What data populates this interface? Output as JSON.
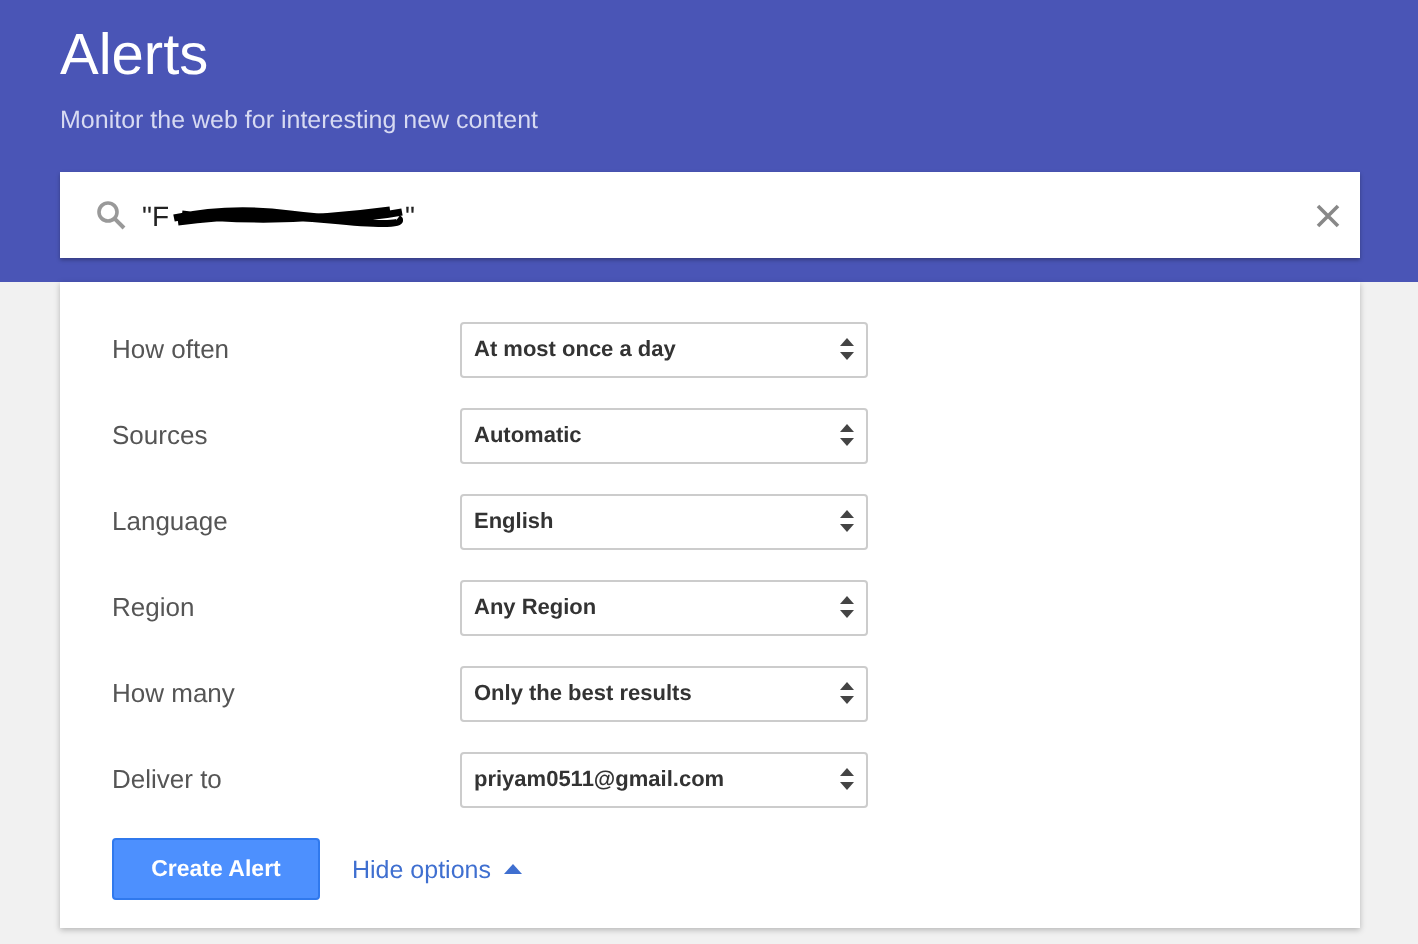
{
  "header": {
    "title": "Alerts",
    "subtitle": "Monitor the web for interesting new content"
  },
  "search": {
    "query_start": "\"F",
    "query_end": "\"",
    "redacted": true
  },
  "options": [
    {
      "label": "How often",
      "value": "At most once a day"
    },
    {
      "label": "Sources",
      "value": "Automatic"
    },
    {
      "label": "Language",
      "value": "English"
    },
    {
      "label": "Region",
      "value": "Any Region"
    },
    {
      "label": "How many",
      "value": "Only the best results"
    },
    {
      "label": "Deliver to",
      "value": "priyam0511@gmail.com"
    }
  ],
  "create_button": "Create Alert",
  "options_link": {
    "label": "Hide options",
    "expanded": true
  }
}
